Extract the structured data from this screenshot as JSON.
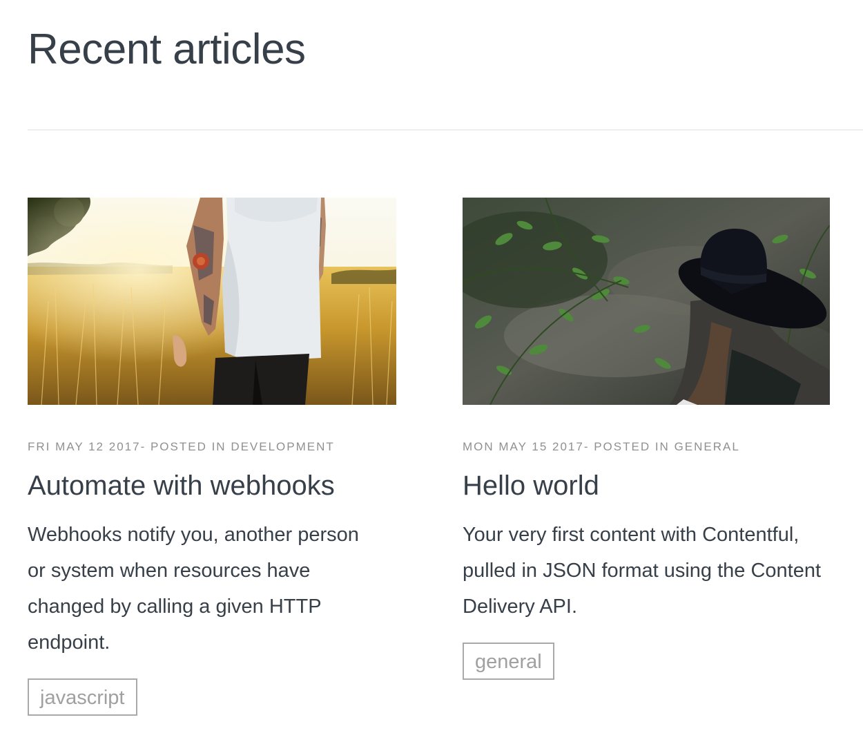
{
  "page": {
    "title": "Recent articles"
  },
  "articles": [
    {
      "image_alt": "Tattooed man in white tank top walking through golden grass field",
      "date": "FRI MAY 12 2017",
      "posted_in_label": "- POSTED IN",
      "category": "DEVELOPMENT",
      "title": "Automate with webhooks",
      "description": "Webhooks notify you, another person or system when resources have changed by calling a given HTTP endpoint.",
      "tag": "javascript"
    },
    {
      "image_alt": "Woman in black hat among green leaves in the forest",
      "date": "MON MAY 15 2017",
      "posted_in_label": "- POSTED IN",
      "category": "GENERAL",
      "title": "Hello world",
      "description": "Your very first content with Contentful, pulled in JSON format using the Content Delivery API.",
      "tag": "general"
    }
  ],
  "colors": {
    "text": "#373f49",
    "meta": "#909090",
    "tag_border": "#a9a9a9",
    "divider": "#eeeeee"
  }
}
